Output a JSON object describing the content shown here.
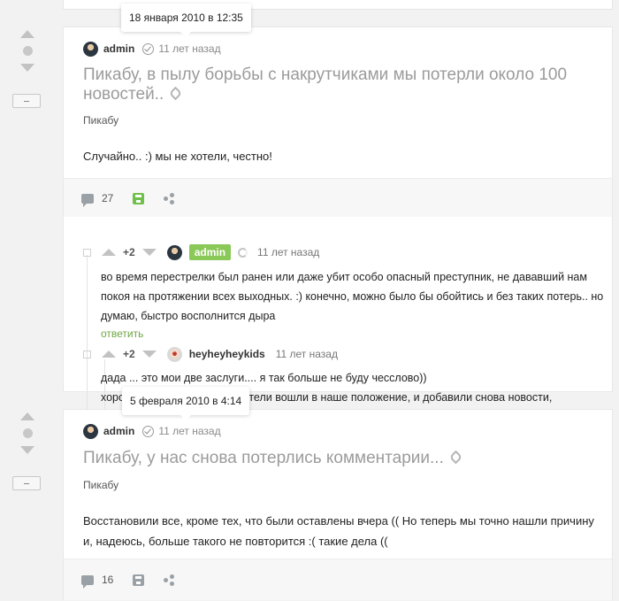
{
  "posts": [
    {
      "tooltip": "18 января 2010 в 12:35",
      "author": "admin",
      "time": "11 лет назад",
      "title": "Пикабу, в пылу борьбы с накрутчиками мы потерли около 100 новостей..",
      "tag": "Пикабу",
      "text": "Случайно.. :) мы не хотели, честно!",
      "comment_count": "27",
      "saved": true,
      "comments": [
        {
          "rating": "+2",
          "author": "admin",
          "time": "11 лет назад",
          "text": "во время перестрелки был ранен или даже убит особо опасный преступник, не дававший нам покоя на протяжении всех выходных. :) конечно, можно было бы обойтись и без таких потерь.. но думаю, быстро восполнится дыра",
          "reply": "ответить"
        },
        {
          "rating": "+2",
          "author": "heyheyheykids",
          "time": "11 лет назад",
          "text_line1": "дада ... это мои две заслуги.... я так больше не буду чесслово))",
          "text_line2": "хорошо что многие пользователи вошли в наше положение, и добавили снова новости,"
        }
      ]
    },
    {
      "tooltip": "5 февраля 2010 в 4:14",
      "author": "admin",
      "time": "11 лет назад",
      "title": "Пикабу, у нас снова потерлись комментарии...",
      "tag": "Пикабу",
      "text": "Восстановили все, кроме тех, что были оставлены вчера (( Но теперь мы точно нашли причину и, надеюсь, больше такого не повторится :( такие дела ((",
      "comment_count": "16",
      "saved": false
    }
  ],
  "colors": {
    "accent_green": "#8ac858",
    "save_active": "#6fbf4b",
    "save_inactive": "#9aa1a6",
    "reply_link": "#6fa642"
  },
  "icons": [
    "rating-up-icon",
    "rating-down-icon",
    "minus-icon",
    "verified-check-icon",
    "link-icon",
    "comment-icon",
    "save-icon",
    "share-icon"
  ]
}
